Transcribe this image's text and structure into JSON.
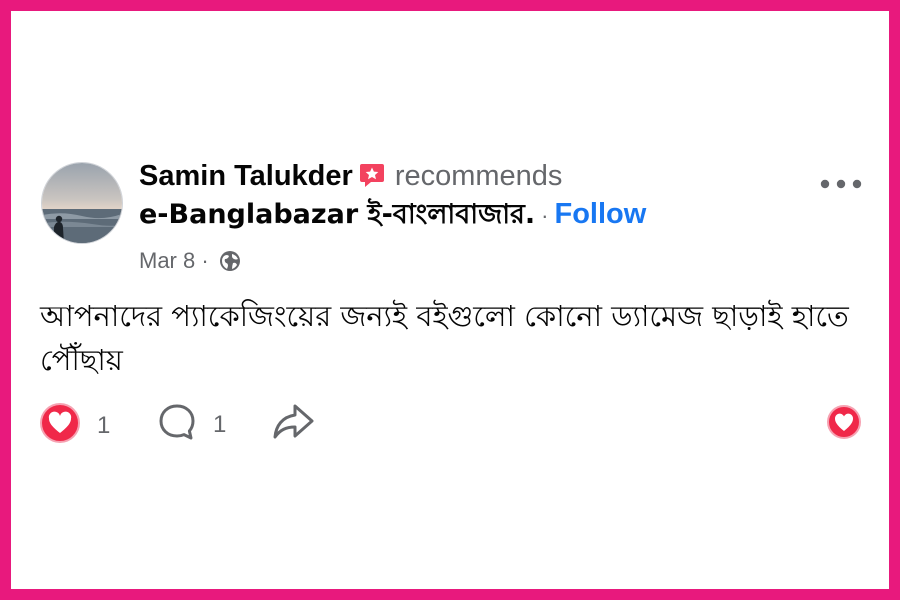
{
  "post": {
    "author": "Samin Talukder",
    "action_text": "recommends",
    "page_name": "e-Banglabazar ই-বাংলাবাজার.",
    "separator": "·",
    "follow_label": "Follow",
    "date": "Mar 8",
    "meta_separator": "·",
    "privacy_icon": "globe-icon",
    "text": "আপনাদের প্যাকেজিংয়ের জন্যই বইগুলো কোনো ড্যামেজ ছাড়াই হাতে পৌঁছায়",
    "reactions": {
      "like_count": "1",
      "comment_count": "1"
    }
  },
  "colors": {
    "frame": "#e8197d",
    "follow": "#1877f2",
    "recommend_badge": "#f3425f",
    "reaction_red": "#f02849",
    "muted_text": "#65676b"
  }
}
